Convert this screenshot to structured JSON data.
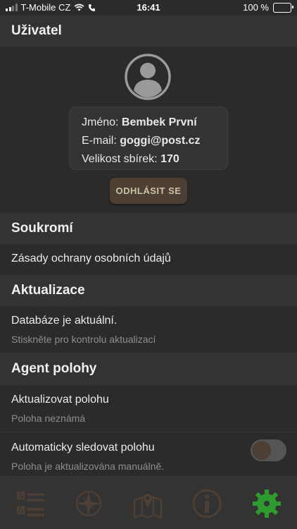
{
  "status_bar": {
    "carrier": "T-Mobile CZ",
    "time": "16:41",
    "battery": "100 %",
    "battery_level": 1.0
  },
  "user_section": {
    "header": "Uživatel",
    "name_label": "Jméno:",
    "name_value": "Bembek První",
    "email_label": "E-mail:",
    "email_value": "goggi@post.cz",
    "collection_label": "Velikost sbírek:",
    "collection_value": "170",
    "logout_label": "ODHLÁSIT SE"
  },
  "privacy_section": {
    "header": "Soukromí",
    "policy_label": "Zásady ochrany osobních údajů"
  },
  "updates_section": {
    "header": "Aktualizace",
    "status_title": "Databáze je aktuální.",
    "status_subtitle": "Stiskněte pro kontrolu aktualizací"
  },
  "location_section": {
    "header": "Agent polohy",
    "update_title": "Aktualizovat polohu",
    "update_subtitle": "Poloha neznámá",
    "auto_title": "Automaticky sledovat polohu",
    "auto_subtitle": "Poloha je aktualizována manuálně.",
    "auto_enabled": false
  },
  "tab_bar": {
    "tabs": [
      {
        "icon": "list-icon",
        "active": false
      },
      {
        "icon": "compass-icon",
        "active": false
      },
      {
        "icon": "map-icon",
        "active": false
      },
      {
        "icon": "info-icon",
        "active": false
      },
      {
        "icon": "gear-icon",
        "active": true
      }
    ]
  },
  "colors": {
    "background": "#2b2b2b",
    "section_header": "#333333",
    "accent_active": "#2f9a2f",
    "icon_inactive": "#4e3f34",
    "button_bg": "#4e3f34",
    "button_text": "#c9c3a4"
  }
}
